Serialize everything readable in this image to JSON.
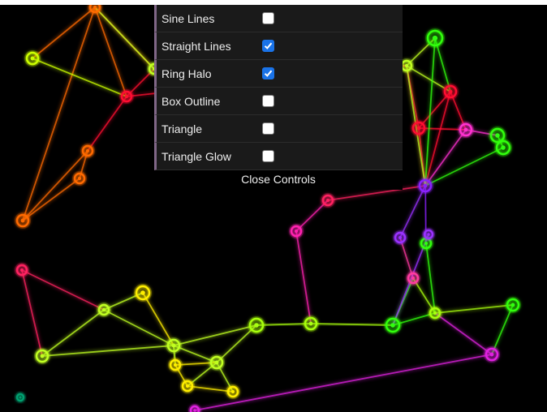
{
  "colors": {
    "panel_bg": "#1a1a1a",
    "panel_accent": "#806787",
    "checkbox_checked": "#1a73e8",
    "canvas_bg": "#000000"
  },
  "controls": {
    "items": [
      {
        "label": "Sine Lines",
        "checked": false
      },
      {
        "label": "Straight Lines",
        "checked": true
      },
      {
        "label": "Ring Halo",
        "checked": true
      },
      {
        "label": "Box Outline",
        "checked": false
      },
      {
        "label": "Triangle",
        "checked": false
      },
      {
        "label": "Triangle Glow",
        "checked": false
      }
    ],
    "close_label": "Close Controls"
  },
  "network": {
    "node_colors": [
      "#ff6a00",
      "#ccff00",
      "#ff1030",
      "#c0ff20",
      "#ff2060",
      "#ff30d0",
      "#8a20ff",
      "#30ff10",
      "#ffee00",
      "#a8ff10",
      "#ff20b0",
      "#9a30ff",
      "#ff3aa0",
      "#50ff10",
      "#e020e0",
      "#00a070"
    ]
  }
}
